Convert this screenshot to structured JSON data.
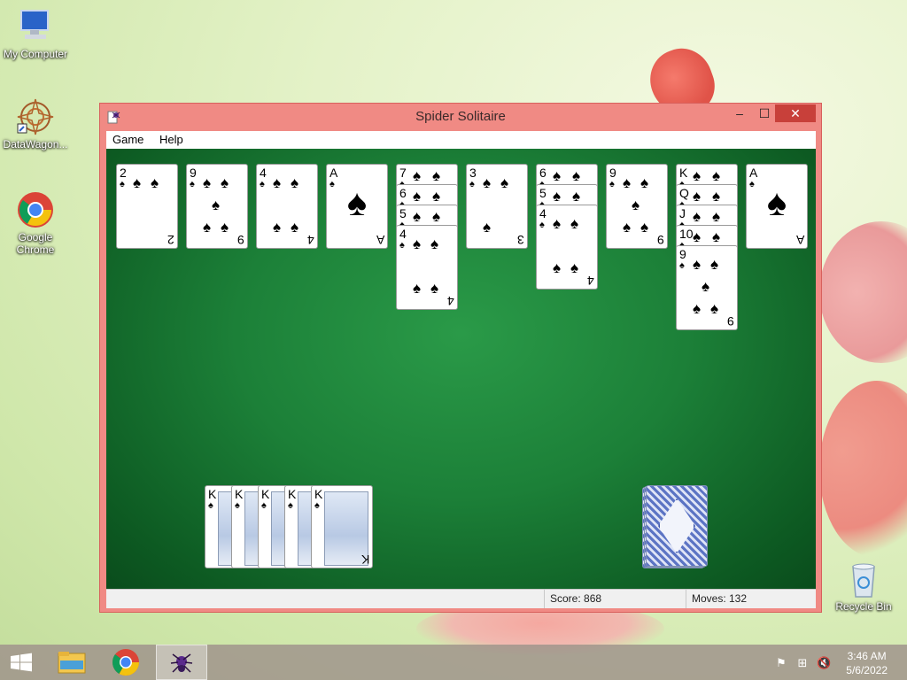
{
  "desktop": {
    "icons": [
      {
        "label": "My Computer",
        "icon": "computer-icon"
      },
      {
        "label": "DataWagon...",
        "icon": "datawagon-icon"
      },
      {
        "label": "Google Chrome",
        "icon": "chrome-icon"
      },
      {
        "label": "Recycle Bin",
        "icon": "recycle-bin-icon"
      }
    ]
  },
  "window": {
    "title": "Spider Solitaire",
    "controls": {
      "minimize": "–",
      "maximize": "☐",
      "close": "✕"
    },
    "menu": [
      "Game",
      "Help"
    ],
    "status": {
      "score_label": "Score: 868",
      "moves_label": "Moves:  132"
    }
  },
  "game": {
    "suit": "♠",
    "foundation_king": "K",
    "tableau": [
      {
        "cards": [
          "2"
        ]
      },
      {
        "cards": [
          "9"
        ]
      },
      {
        "cards": [
          "4"
        ]
      },
      {
        "cards": [
          "A"
        ]
      },
      {
        "cards": [
          "7",
          "6",
          "5",
          "4"
        ]
      },
      {
        "cards": [
          "3"
        ]
      },
      {
        "cards": [
          "6",
          "5",
          "4"
        ]
      },
      {
        "cards": [
          "9"
        ]
      },
      {
        "cards": [
          "K",
          "Q",
          "J",
          "10",
          "9"
        ]
      },
      {
        "cards": [
          "A"
        ]
      }
    ],
    "completed_sequences": 5,
    "stock_deals_remaining": 3
  },
  "taskbar": {
    "items": [
      "start-icon",
      "file-explorer-icon",
      "chrome-icon",
      "spider-solitaire-icon"
    ],
    "clock": {
      "time": "3:46 AM",
      "date": "5/6/2022"
    }
  },
  "colors": {
    "window_frame": "#f08a84",
    "felt": "#1c8038",
    "close_button": "#c8403a"
  }
}
